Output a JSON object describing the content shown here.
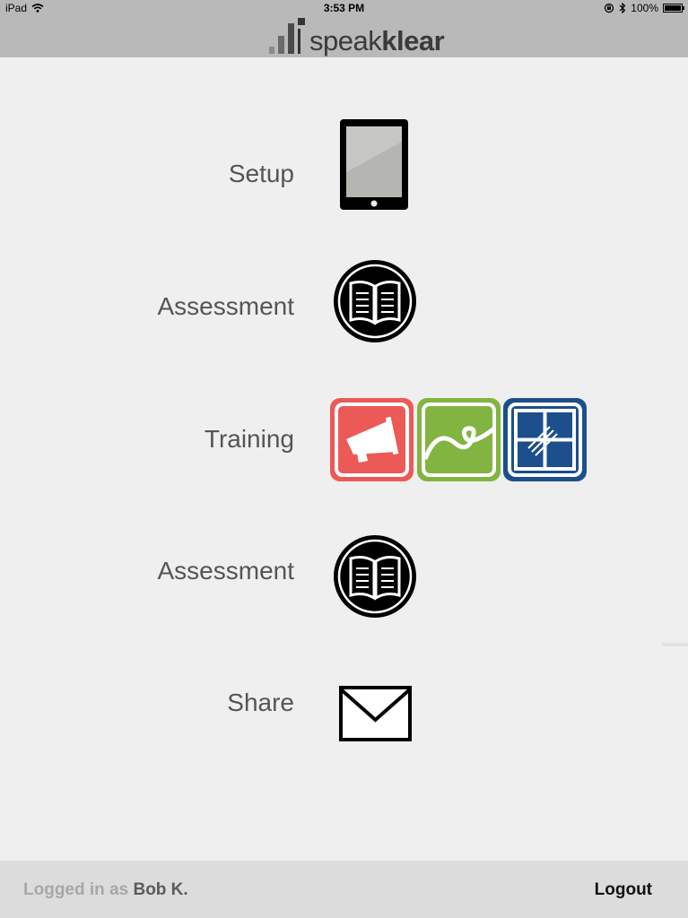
{
  "status_bar": {
    "device": "iPad",
    "time": "3:53 PM",
    "battery": "100%",
    "icons": [
      "wifi-icon",
      "orientation-lock-icon",
      "bluetooth-icon",
      "battery-icon"
    ]
  },
  "header": {
    "logo_thin": "speak",
    "logo_bold": "klear",
    "background": "#b9b9b9"
  },
  "menu": {
    "items": [
      {
        "label": "Setup",
        "icon": "tablet-icon"
      },
      {
        "label": "Assessment",
        "icon": "book-icon"
      },
      {
        "label": "Training",
        "icons": [
          "megaphone-icon",
          "wave-icon",
          "window-icon"
        ]
      },
      {
        "label": "Assessment",
        "icon": "book-icon"
      },
      {
        "label": "Share",
        "icon": "envelope-icon"
      }
    ]
  },
  "colors": {
    "background": "#efefef",
    "training_red": "#eb5a57",
    "training_green": "#82b441",
    "training_blue": "#1d4f8c",
    "footer": "#dcdcdd"
  },
  "footer": {
    "logged_in_prefix": "Logged in as",
    "user_name": "Bob K.",
    "logout_label": "Logout"
  }
}
